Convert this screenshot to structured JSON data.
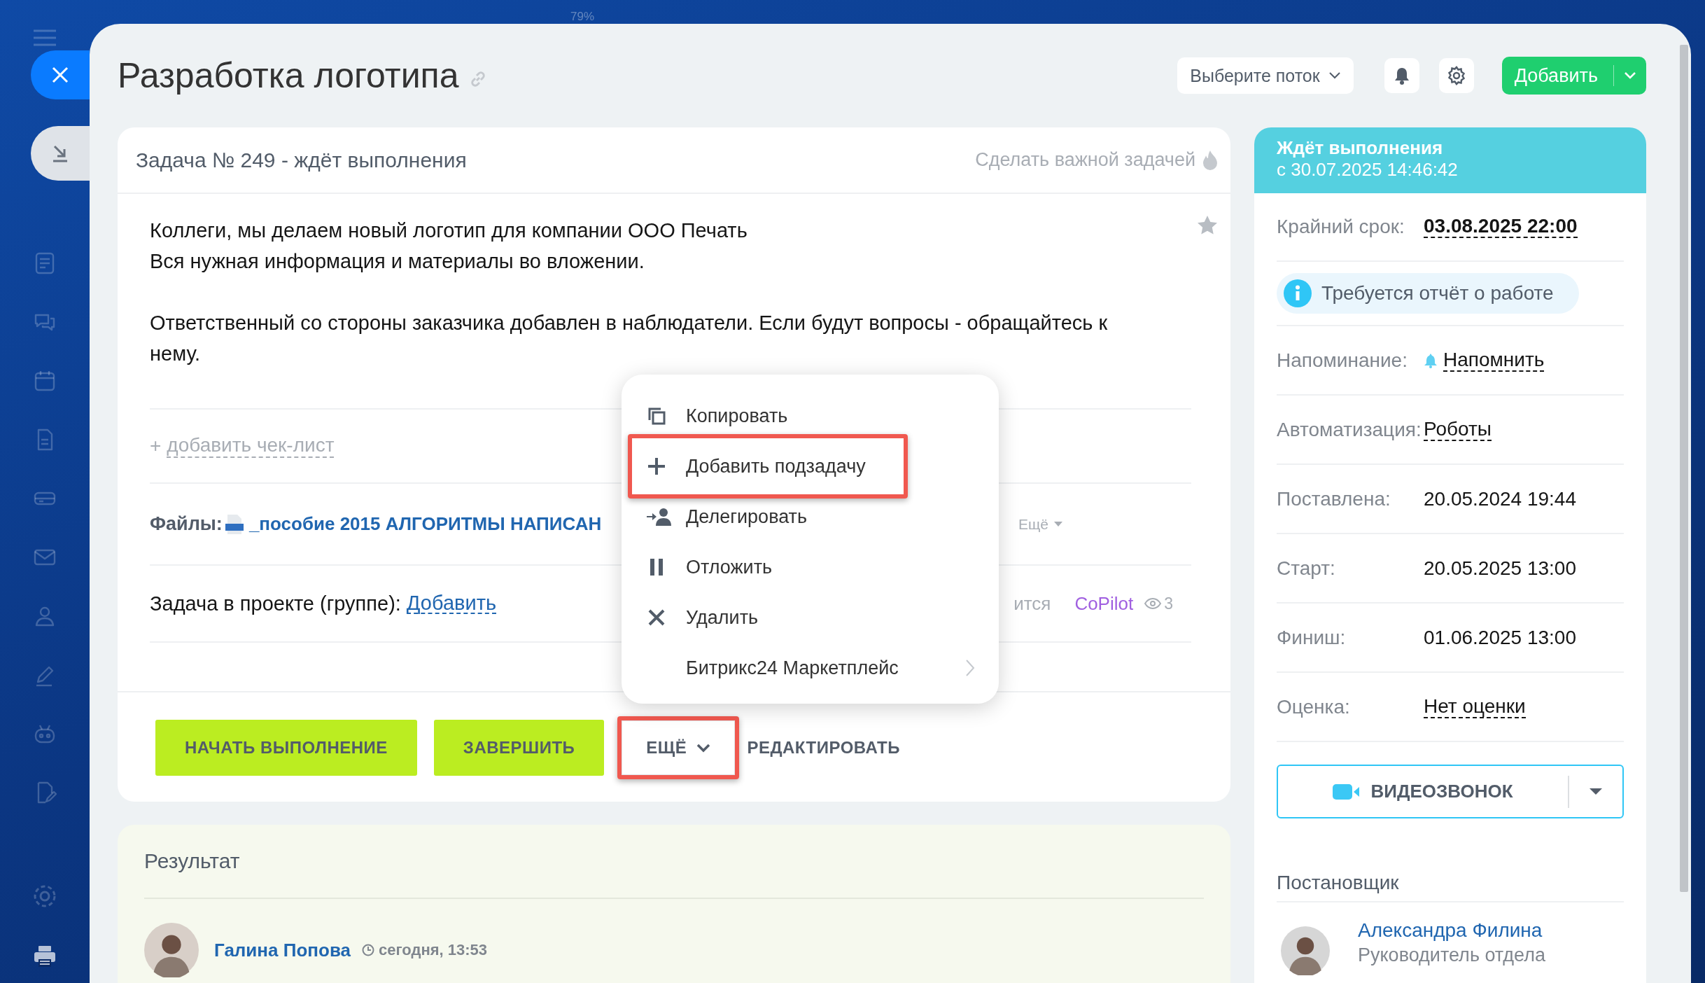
{
  "zoom_label": "79%",
  "title": "Разработка логотипа",
  "header": {
    "flow_select": "Выберите поток",
    "add_button": "Добавить"
  },
  "task": {
    "heading": "Задача № 249 - ждёт выполнения",
    "important_link": "Сделать важной задачей",
    "description": [
      [
        "Коллеги, мы делаем новый логотип для компании ООО Печать",
        "Вся нужная информация и материалы во вложении."
      ],
      [
        "Ответственный со стороны заказчика добавлен в наблюдатели. Если будут вопросы - обращайтесь к нему."
      ]
    ],
    "checklist": {
      "plus": "+",
      "link": "добавить чек-лист"
    },
    "files": {
      "label": "Файлы:",
      "file_name": "_пособие 2015 АЛГОРИТМЫ НАПИСАН",
      "more": "Ещё"
    },
    "project": {
      "label": "Задача в проекте (группе):",
      "link": "Добавить",
      "partial_text": "ится",
      "group": "CoPilot",
      "watchers": "3"
    }
  },
  "actions": [
    {
      "label": "НАЧАТЬ ВЫПОЛНЕНИЕ",
      "kind": "primary",
      "highlighted": false
    },
    {
      "label": "ЗАВЕРШИТЬ",
      "kind": "primary",
      "highlighted": false
    },
    {
      "label": "ЕЩЁ",
      "kind": "dropdown",
      "highlighted": true
    },
    {
      "label": "РЕДАКТИРОВАТЬ",
      "kind": "text",
      "highlighted": false
    }
  ],
  "menu": [
    {
      "label": "Копировать",
      "highlighted": false,
      "submenu": false
    },
    {
      "label": "Добавить подзадачу",
      "highlighted": true,
      "submenu": false
    },
    {
      "label": "Делегировать",
      "highlighted": false,
      "submenu": false
    },
    {
      "label": "Отложить",
      "highlighted": false,
      "submenu": false
    },
    {
      "label": "Удалить",
      "highlighted": false,
      "submenu": false
    },
    {
      "label": "Битрикс24 Маркетплейс",
      "highlighted": false,
      "submenu": true
    }
  ],
  "result": {
    "title": "Результат",
    "author": "Галина Попова",
    "time": "сегодня, 13:53"
  },
  "status": {
    "title": "Ждёт выполнения",
    "since": "с 30.07.2025 14:46:42"
  },
  "details": [
    {
      "kind": "deadline",
      "label": "Крайний срок:",
      "value": "03.08.2025 22:00"
    },
    {
      "kind": "notice",
      "text": "Требуется отчёт о работе"
    },
    {
      "kind": "reminder",
      "label": "Напоминание:",
      "value": "Напомнить"
    },
    {
      "kind": "link",
      "label": "Автоматизация:",
      "value": "Роботы"
    },
    {
      "kind": "plain",
      "label": "Поставлена:",
      "value": "20.05.2024 19:44"
    },
    {
      "kind": "plain",
      "label": "Старт:",
      "value": "20.05.2025 13:00"
    },
    {
      "kind": "plain",
      "label": "Финиш:",
      "value": "01.06.2025 13:00"
    },
    {
      "kind": "link",
      "label": "Оценка:",
      "value": "Нет оценки"
    }
  ],
  "video_call": "ВИДЕОЗВОНОК",
  "creator": {
    "title": "Постановщик",
    "name": "Александра Филина",
    "role": "Руководитель отдела"
  }
}
